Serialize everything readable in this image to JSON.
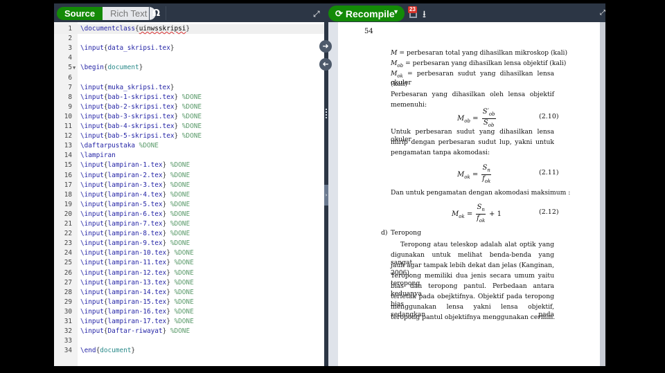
{
  "toolbar": {
    "source_label": "Source",
    "rich_text_label": "Rich Text",
    "symbol_icon": "Ω",
    "recompile_label": "Recompile",
    "log_badge_count": "23",
    "accent_color": "#138a07"
  },
  "editor": {
    "lines": [
      {
        "n": "1",
        "parts": [
          [
            "cmd",
            "\\documentclass"
          ],
          [
            "br",
            "{"
          ],
          [
            "sp",
            "uinwsskripsi"
          ],
          [
            "br",
            "}"
          ]
        ]
      },
      {
        "n": "2",
        "parts": []
      },
      {
        "n": "3",
        "parts": [
          [
            "cmd",
            "\\input"
          ],
          [
            "br",
            "{"
          ],
          [
            "arg",
            "data_skripsi.tex"
          ],
          [
            "br",
            "}"
          ]
        ]
      },
      {
        "n": "4",
        "parts": []
      },
      {
        "n": "5",
        "fold": true,
        "parts": [
          [
            "cmd",
            "\\begin"
          ],
          [
            "br",
            "{"
          ],
          [
            "env",
            "document"
          ],
          [
            "br",
            "}"
          ]
        ]
      },
      {
        "n": "6",
        "parts": []
      },
      {
        "n": "7",
        "parts": [
          [
            "cmd",
            "\\input"
          ],
          [
            "br",
            "{"
          ],
          [
            "arg",
            "muka_skripsi.tex"
          ],
          [
            "br",
            "}"
          ]
        ]
      },
      {
        "n": "8",
        "parts": [
          [
            "cmd",
            "\\input"
          ],
          [
            "br",
            "{"
          ],
          [
            "arg",
            "bab-1-skripsi.tex"
          ],
          [
            "br",
            "}"
          ],
          [
            "cm",
            " %DONE"
          ]
        ]
      },
      {
        "n": "9",
        "parts": [
          [
            "cmd",
            "\\input"
          ],
          [
            "br",
            "{"
          ],
          [
            "arg",
            "bab-2-skripsi.tex"
          ],
          [
            "br",
            "}"
          ],
          [
            "cm",
            " %DONE"
          ]
        ]
      },
      {
        "n": "10",
        "parts": [
          [
            "cmd",
            "\\input"
          ],
          [
            "br",
            "{"
          ],
          [
            "arg",
            "bab-3-skripsi.tex"
          ],
          [
            "br",
            "}"
          ],
          [
            "cm",
            " %DONE"
          ]
        ]
      },
      {
        "n": "11",
        "parts": [
          [
            "cmd",
            "\\input"
          ],
          [
            "br",
            "{"
          ],
          [
            "arg",
            "bab-4-skripsi.tex"
          ],
          [
            "br",
            "}"
          ],
          [
            "cm",
            " %DONE"
          ]
        ]
      },
      {
        "n": "12",
        "parts": [
          [
            "cmd",
            "\\input"
          ],
          [
            "br",
            "{"
          ],
          [
            "arg",
            "bab-5-skripsi.tex"
          ],
          [
            "br",
            "}"
          ],
          [
            "cm",
            " %DONE"
          ]
        ]
      },
      {
        "n": "13",
        "parts": [
          [
            "cmd",
            "\\daftarpustaka"
          ],
          [
            "cm",
            " %DONE"
          ]
        ]
      },
      {
        "n": "14",
        "parts": [
          [
            "cmd",
            "\\lampiran"
          ]
        ]
      },
      {
        "n": "15",
        "parts": [
          [
            "cmd",
            "\\input"
          ],
          [
            "br",
            "{"
          ],
          [
            "arg",
            "lampiran-1.tex"
          ],
          [
            "br",
            "}"
          ],
          [
            "cm",
            " %DONE"
          ]
        ]
      },
      {
        "n": "16",
        "parts": [
          [
            "cmd",
            "\\input"
          ],
          [
            "br",
            "{"
          ],
          [
            "arg",
            "lampiran-2.tex"
          ],
          [
            "br",
            "}"
          ],
          [
            "cm",
            " %DONE"
          ]
        ]
      },
      {
        "n": "17",
        "parts": [
          [
            "cmd",
            "\\input"
          ],
          [
            "br",
            "{"
          ],
          [
            "arg",
            "lampiran-3.tex"
          ],
          [
            "br",
            "}"
          ],
          [
            "cm",
            " %DONE"
          ]
        ]
      },
      {
        "n": "18",
        "parts": [
          [
            "cmd",
            "\\input"
          ],
          [
            "br",
            "{"
          ],
          [
            "arg",
            "lampiran-4.tex"
          ],
          [
            "br",
            "}"
          ],
          [
            "cm",
            " %DONE"
          ]
        ]
      },
      {
        "n": "19",
        "parts": [
          [
            "cmd",
            "\\input"
          ],
          [
            "br",
            "{"
          ],
          [
            "arg",
            "lampiran-5.tex"
          ],
          [
            "br",
            "}"
          ],
          [
            "cm",
            " %DONE"
          ]
        ]
      },
      {
        "n": "20",
        "parts": [
          [
            "cmd",
            "\\input"
          ],
          [
            "br",
            "{"
          ],
          [
            "arg",
            "lampiran-6.tex"
          ],
          [
            "br",
            "}"
          ],
          [
            "cm",
            " %DONE"
          ]
        ]
      },
      {
        "n": "21",
        "parts": [
          [
            "cmd",
            "\\input"
          ],
          [
            "br",
            "{"
          ],
          [
            "arg",
            "lampiran-7.tex"
          ],
          [
            "br",
            "}"
          ],
          [
            "cm",
            " %DONE"
          ]
        ]
      },
      {
        "n": "22",
        "parts": [
          [
            "cmd",
            "\\input"
          ],
          [
            "br",
            "{"
          ],
          [
            "arg",
            "lampiran-8.tex"
          ],
          [
            "br",
            "}"
          ],
          [
            "cm",
            " %DONE"
          ]
        ]
      },
      {
        "n": "23",
        "parts": [
          [
            "cmd",
            "\\input"
          ],
          [
            "br",
            "{"
          ],
          [
            "arg",
            "lampiran-9.tex"
          ],
          [
            "br",
            "}"
          ],
          [
            "cm",
            " %DONE"
          ]
        ]
      },
      {
        "n": "24",
        "parts": [
          [
            "cmd",
            "\\input"
          ],
          [
            "br",
            "{"
          ],
          [
            "arg",
            "lampiran-10.tex"
          ],
          [
            "br",
            "}"
          ],
          [
            "cm",
            " %DONE"
          ]
        ]
      },
      {
        "n": "25",
        "parts": [
          [
            "cmd",
            "\\input"
          ],
          [
            "br",
            "{"
          ],
          [
            "arg",
            "lampiran-11.tex"
          ],
          [
            "br",
            "}"
          ],
          [
            "cm",
            " %DONE"
          ]
        ]
      },
      {
        "n": "26",
        "parts": [
          [
            "cmd",
            "\\input"
          ],
          [
            "br",
            "{"
          ],
          [
            "arg",
            "lampiran-12.tex"
          ],
          [
            "br",
            "}"
          ],
          [
            "cm",
            " %DONE"
          ]
        ]
      },
      {
        "n": "27",
        "parts": [
          [
            "cmd",
            "\\input"
          ],
          [
            "br",
            "{"
          ],
          [
            "arg",
            "lampiran-13.tex"
          ],
          [
            "br",
            "}"
          ],
          [
            "cm",
            " %DONE"
          ]
        ]
      },
      {
        "n": "28",
        "parts": [
          [
            "cmd",
            "\\input"
          ],
          [
            "br",
            "{"
          ],
          [
            "arg",
            "lampiran-14.tex"
          ],
          [
            "br",
            "}"
          ],
          [
            "cm",
            " %DONE"
          ]
        ]
      },
      {
        "n": "29",
        "parts": [
          [
            "cmd",
            "\\input"
          ],
          [
            "br",
            "{"
          ],
          [
            "arg",
            "lampiran-15.tex"
          ],
          [
            "br",
            "}"
          ],
          [
            "cm",
            " %DONE"
          ]
        ]
      },
      {
        "n": "30",
        "parts": [
          [
            "cmd",
            "\\input"
          ],
          [
            "br",
            "{"
          ],
          [
            "arg",
            "lampiran-16.tex"
          ],
          [
            "br",
            "}"
          ],
          [
            "cm",
            " %DONE"
          ]
        ]
      },
      {
        "n": "31",
        "parts": [
          [
            "cmd",
            "\\input"
          ],
          [
            "br",
            "{"
          ],
          [
            "arg",
            "lampiran-17.tex"
          ],
          [
            "br",
            "}"
          ],
          [
            "cm",
            " %DONE"
          ]
        ]
      },
      {
        "n": "32",
        "parts": [
          [
            "cmd",
            "\\input"
          ],
          [
            "br",
            "{"
          ],
          [
            "arg",
            "Daftar-riwayat"
          ],
          [
            "br",
            "}"
          ],
          [
            "cm",
            " %DONE"
          ]
        ]
      },
      {
        "n": "33",
        "parts": []
      },
      {
        "n": "34",
        "parts": [
          [
            "cmd",
            "\\end"
          ],
          [
            "br",
            "{"
          ],
          [
            "env",
            "document"
          ],
          [
            "br",
            "}"
          ]
        ]
      }
    ]
  },
  "pdf": {
    "page_number": "54",
    "def_m_sym": "M",
    "def_m_text": " = perbesaran total yang dihasilkan mikroskop (kali)",
    "def_mob_sym": "M",
    "def_mob_sub": "ob",
    "def_mob_text": " = perbesaran yang dihasilkan lensa objektif (kali)",
    "def_mok_sym": "M",
    "def_mok_sub": "ok",
    "def_mok_text": " = perbesaran sudut yang dihasilkan lensa okuler",
    "def_mok_cont": "(kali)",
    "para1_line1": "Perbesaran yang dihasilkan oleh lensa objektif",
    "para1_line2": "memenuhi:",
    "eq1": {
      "lhs": "M",
      "lhs_sub": "ob",
      "num": "S′",
      "num_sub": "ob",
      "den": "S",
      "den_sub": "ob",
      "tail": "",
      "no": "(2.10)"
    },
    "para2_line1": "Untuk perbesaran sudut yang dihasilkan lensa okuler",
    "para2_line2": "mirip dengan perbesaran sudut lup, yakni untuk",
    "para2_line3": "pengamatan tanpa akomodasi:",
    "eq2": {
      "lhs": "M",
      "lhs_sub": "ok",
      "num": "S",
      "num_sub": "n",
      "den": "f",
      "den_sub": "ok",
      "tail": "",
      "no": "(2.11)"
    },
    "para3": "Dan untuk pengamatan dengan akomodasi maksimum :",
    "eq3": {
      "lhs": "M",
      "lhs_sub": "ok",
      "num": "S",
      "num_sub": "n",
      "den": "f",
      "den_sub": "ok",
      "tail": "+ 1",
      "no": "(2.12)"
    },
    "section_marker": "d)",
    "section_title": "Teropong",
    "para4": [
      "Teropong atau teleskop adalah alat optik yang",
      "digunakan untuk melihat benda-benda yang sangat",
      "jauh agar tampak lebih dekat dan jelas (Kanginan, 2006).",
      "Teropong memiliki dua jenis secara umum yaitu teropong",
      "bias dan teropong pantul.  Perbedaan antara keduanya",
      "terletak pada obejktifnya.  Objektif pada teropong bias",
      "menggunakan lensa yakni lensa objektif, sedangkan pada",
      "teropong pantul objektifnya menggunakan cermin."
    ]
  }
}
